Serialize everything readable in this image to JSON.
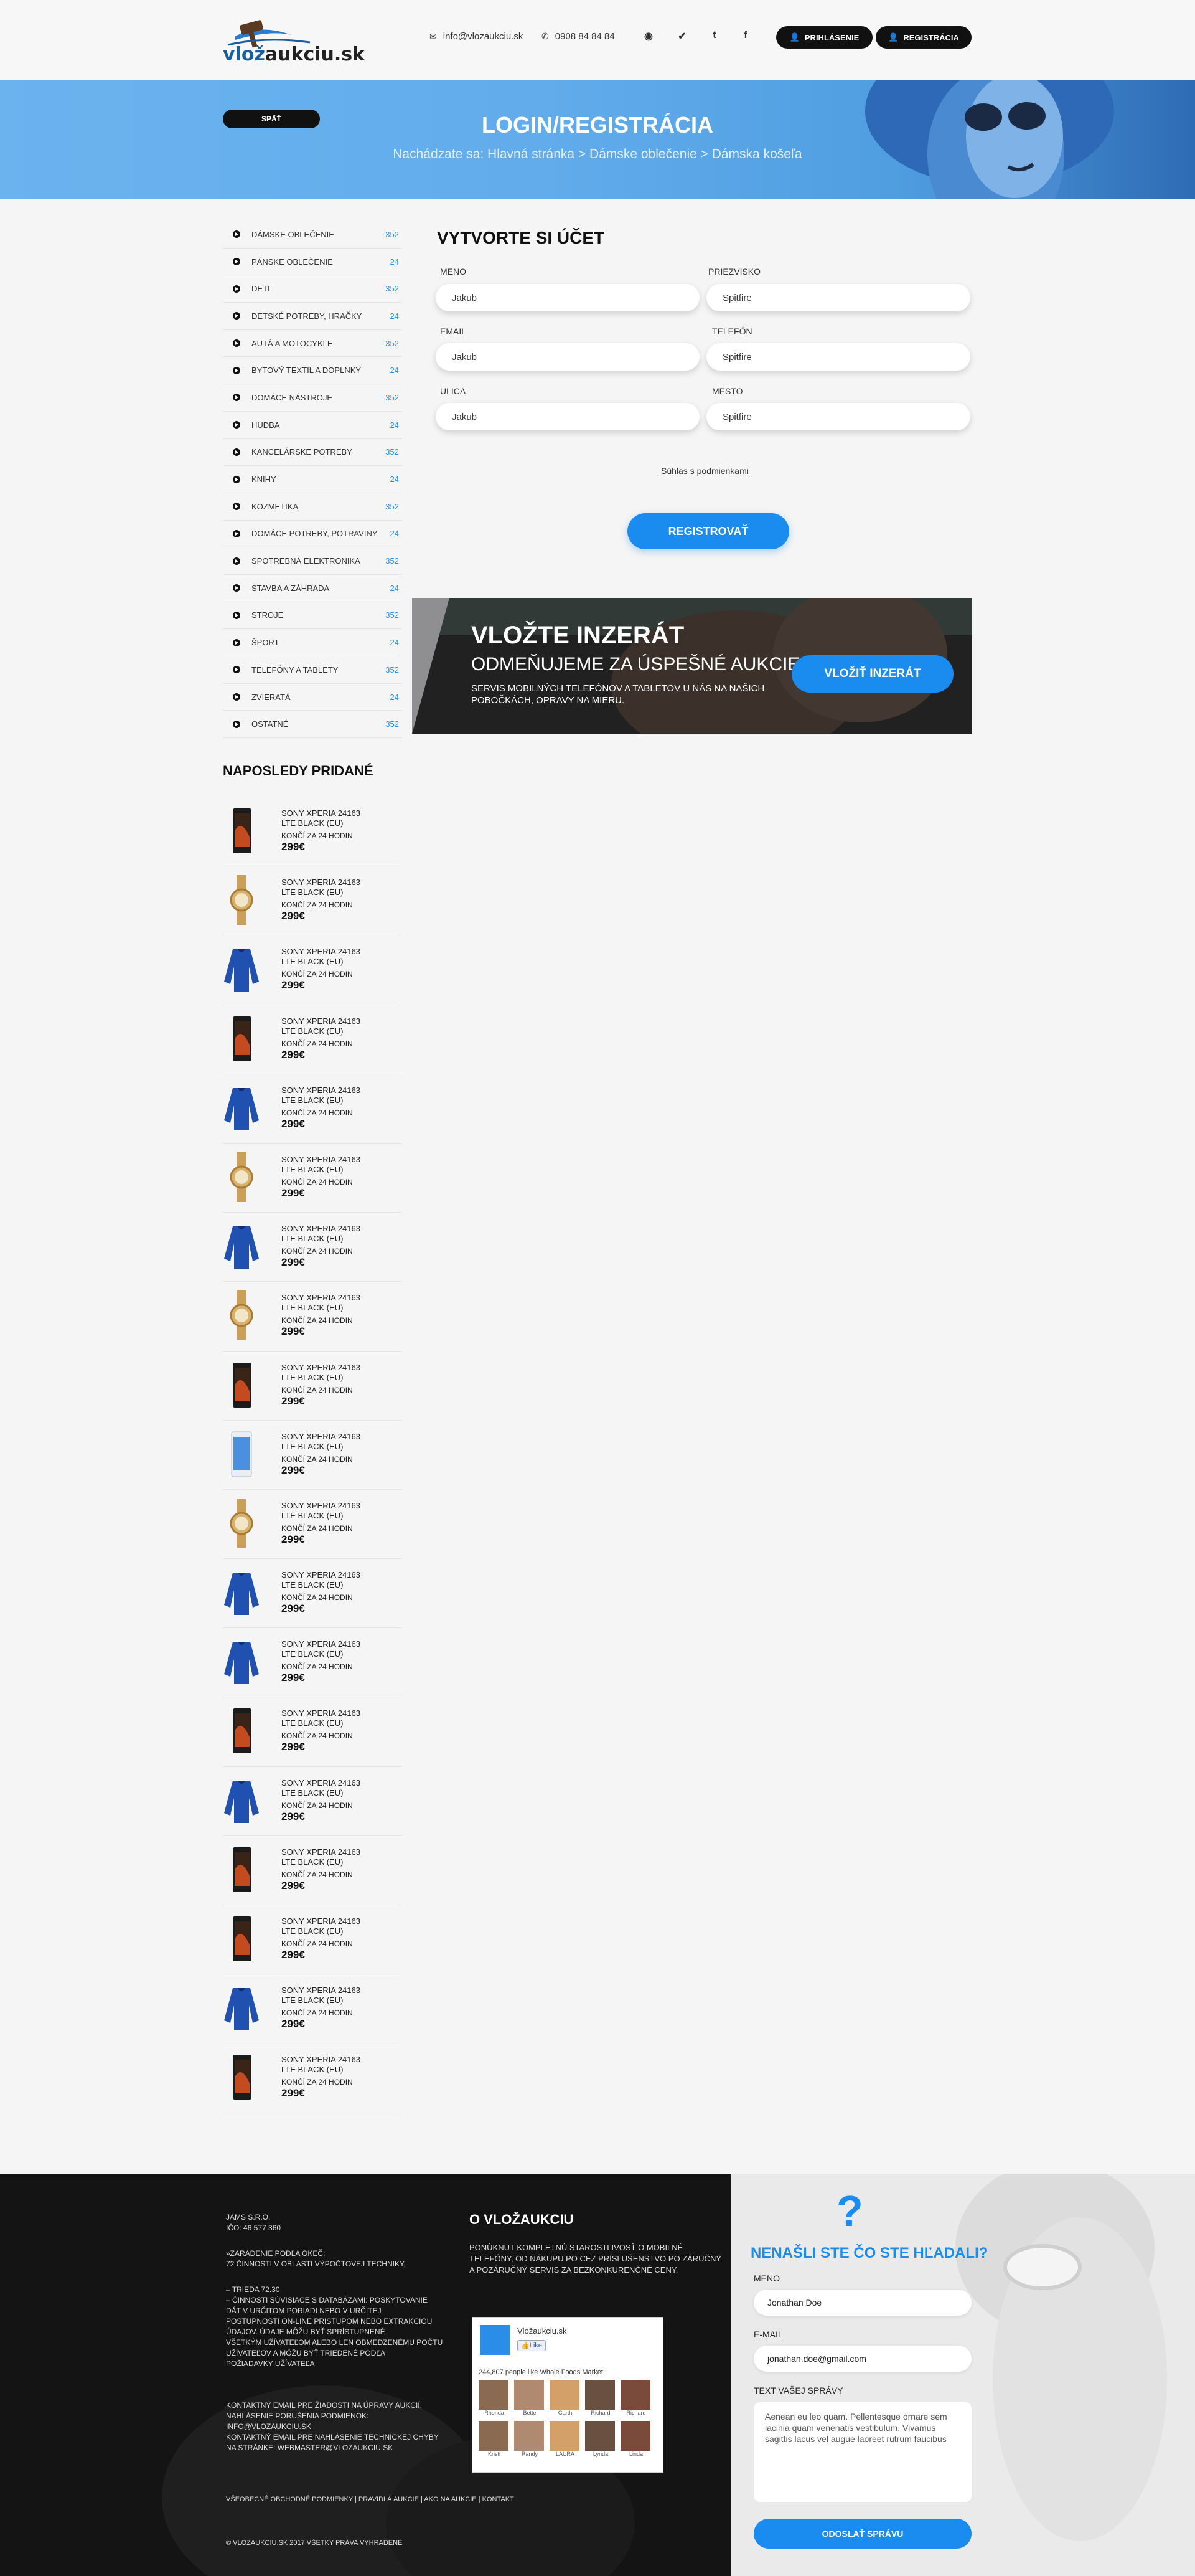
{
  "header": {
    "logo_text_a": "vlož",
    "logo_text_b": "aukciu.sk",
    "email": "info@vlozaukciu.sk",
    "phone": "0908 84 84 84",
    "login_label": "PRIHLÁSENIE",
    "register_label": "REGISTRÁCIA"
  },
  "hero": {
    "back_label": "SPÄŤ",
    "title": "LOGIN/REGISTRÁCIA",
    "breadcrumb": "Nachádzate sa: Hlavná stránka > Dámske oblečenie > Dámska košeľa"
  },
  "categories": [
    {
      "label": "DÁMSKE OBLEČENIE",
      "count": "352"
    },
    {
      "label": "PÁNSKE OBLEČENIE",
      "count": "24"
    },
    {
      "label": "DETI",
      "count": "352"
    },
    {
      "label": "DETSKÉ POTREBY, HRAČKY",
      "count": "24"
    },
    {
      "label": "AUTÁ A MOTOCYKLE",
      "count": "352"
    },
    {
      "label": "BYTOVÝ TEXTIL A DOPLNKY",
      "count": "24"
    },
    {
      "label": "DOMÁCE NÁSTROJE",
      "count": "352"
    },
    {
      "label": "HUDBA",
      "count": "24"
    },
    {
      "label": "KANCELÁRSKE POTREBY",
      "count": "352"
    },
    {
      "label": "KNIHY",
      "count": "24"
    },
    {
      "label": "KOZMETIKA",
      "count": "352"
    },
    {
      "label": "DOMÁCE POTREBY, POTRAVINY",
      "count": "24"
    },
    {
      "label": "SPOTREBNÁ ELEKTRONIKA",
      "count": "352"
    },
    {
      "label": "STAVBA A ZÁHRADA",
      "count": "24"
    },
    {
      "label": "STROJE",
      "count": "352"
    },
    {
      "label": "ŠPORT",
      "count": "24"
    },
    {
      "label": "TELEFÓNY A TABLETY",
      "count": "352"
    },
    {
      "label": "ZVIERATÁ",
      "count": "24"
    },
    {
      "label": "OSTATNÉ",
      "count": "352"
    }
  ],
  "recent": {
    "title": "NAPOSLEDY PRIDANÉ",
    "item_name": "SONY XPERIA 24163 LTE BLACK (EU)",
    "ends": "KONČÍ ZA 24 HODIN",
    "price": "299€",
    "thumbs": [
      "phone",
      "watch",
      "sweater",
      "phone",
      "sweater",
      "watch",
      "sweater",
      "watch",
      "phone",
      "phone-white",
      "watch",
      "sweater",
      "sweater",
      "phone",
      "sweater",
      "phone",
      "phone",
      "sweater",
      "phone"
    ]
  },
  "form": {
    "title": "VYTVORTE SI ÚČET",
    "first_name_label": "MENO",
    "first_name_value": "Jakub",
    "last_name_label": "PRIEZVISKO",
    "last_name_value": "Spitfire",
    "email_label": "EMAIL",
    "email_value": "Jakub",
    "phone_label": "TELEFÓN",
    "phone_value": "Spitfire",
    "street_label": "ULICA",
    "street_value": "Jakub",
    "city_label": "MESTO",
    "city_value": "Spitfire",
    "agree_label": "Súhlas s podmienkami",
    "submit_label": "REGISTROVAŤ"
  },
  "banner": {
    "title": "VLOŽTE INZERÁT",
    "subtitle": "ODMEŇUJEME ZA ÚSPEŠNÉ AUKCIE",
    "text": "SERVIS MOBILNÝCH TELEFÓNOV A TABLETOV U NÁS NA NAŠICH POBOČKÁCH, OPRAVY NA MIERU.",
    "button": "VLOŽIŤ INZERÁT"
  },
  "footer": {
    "company_lines": [
      "JAMS S.R.O.",
      "IČO: 46 577 360"
    ],
    "classification_lines": [
      "»ZARADENIE PODĽA OKEČ:",
      "72 ČINNOSTI V OBLASTI VÝPOČTOVEJ TECHNIKY,"
    ],
    "details_lines": [
      "– TRIEDA 72.30",
      "– ČINNOSTI SÚVISIACE S DATABÁZAMI: POSKYTOVANIE DÁT V URČITOM PORIADI NEBO V URČITEJ",
      "POSTUPNOSTI ON-LINE PRÍSTUPOM NEBO EXTRAKCIOU ÚDAJOV. ÚDAJE MÔŽU BYŤ SPRÍSTUPNENÉ",
      "VŠETKÝM UŽÍVATEĽOM ALEBO LEN OBMEDZENÉMU POČTU UŽÍVATEĽOV A MÔŽU BYŤ TRIEDENÉ PODĽA",
      "POŽIADAVKY UŽÍVATEĽA"
    ],
    "contact_lines": [
      "KONTAKTNÝ EMAIL PRE ŽIADOSTI NA ÚPRAVY AUKCIÍ,",
      "NAHLÁSENIE PORUŠENIA PODMIENOK:",
      "INFO@VLOZAUKCIU.SK",
      "KONTAKTNÝ EMAIL PRE NAHLÁSENIE TECHNICKEJ CHYBY",
      "NA STRÁNKE: WEBMASTER@VLOZAUKCIU.SK"
    ],
    "links": "VŠEOBECNÉ OBCHODNÉ PODMIENKY | PRAVIDLÁ AUKCIE | AKO NA AUKCIE | KONTAKT",
    "copyright": "© VLOZAUKCIU.SK 2017 VŠETKY PRÁVA VYHRADENÉ",
    "about_title": "O VLOŽAUKCIU",
    "about_text": "PONÚKNUT KOMPLETNÚ STAROSTLIVOSŤ O MOBILNÉ TELEFÓNY, OD NÁKUPU PO CEZ PRÍSLUŠENSTVO PO ZÁRUČNÝ A POZÁRUČNÝ SERVIS ZA BEZKONKURENČNÉ CENY.",
    "fb_name": "Vložaukciu.sk",
    "fb_like": "Like",
    "fb_count": "244,807 people like Whole Foods Market",
    "fb_people": [
      "Rhonda",
      "Bette",
      "Garth",
      "Richard",
      "Richard",
      "Kristi",
      "Randy",
      "LAURA",
      "Lynda",
      "Linda"
    ]
  },
  "contact": {
    "title": "NENAŠLI STE ČO STE HĽADALI?",
    "name_label": "MENO",
    "name_value": "Jonathan Doe",
    "email_label": "E-MAIL",
    "email_value": "jonathan.doe@gmail.com",
    "message_label": "TEXT VAŠEJ SPRÁVY",
    "message_value": "Aenean eu leo quam. Pellentesque ornare sem lacinia quam venenatis vestibulum. Vivamus sagittis lacus vel augue laoreet rutrum faucibus",
    "send_label": "ODOSLAŤ SPRÁVU"
  }
}
